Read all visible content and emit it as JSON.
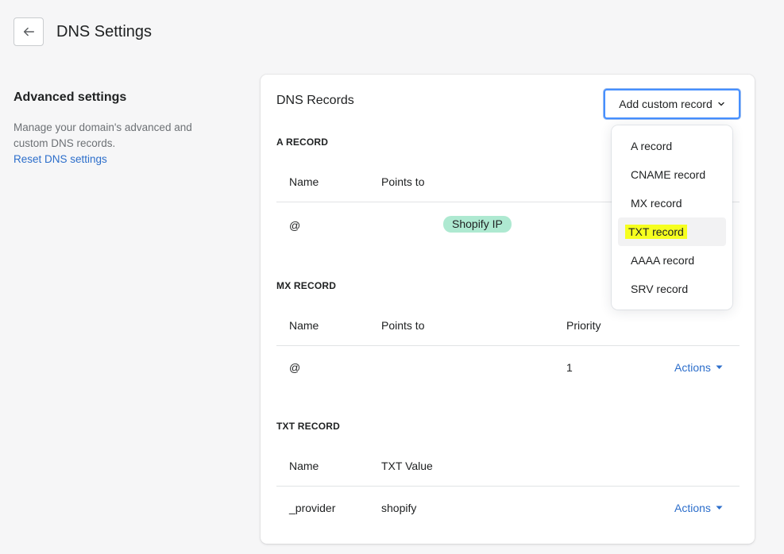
{
  "header": {
    "title": "DNS Settings",
    "back_icon": "arrow-left-icon"
  },
  "sidebar": {
    "heading": "Advanced settings",
    "description": "Manage your domain's advanced and custom DNS records.",
    "reset_link": "Reset DNS settings"
  },
  "card": {
    "title": "DNS Records",
    "add_button_label": "Add custom record",
    "add_button_icon": "chevron-down-icon"
  },
  "a_record": {
    "heading": "A RECORD",
    "columns": [
      "Name",
      "Points to"
    ],
    "rows": [
      {
        "name": "@",
        "points_to": "Shopify IP"
      }
    ]
  },
  "mx_record": {
    "heading": "MX RECORD",
    "columns": [
      "Name",
      "Points to",
      "Priority"
    ],
    "rows": [
      {
        "name": "@",
        "points_to": "",
        "priority": "1",
        "actions": "Actions"
      }
    ]
  },
  "txt_record": {
    "heading": "TXT RECORD",
    "columns": [
      "Name",
      "TXT Value"
    ],
    "rows": [
      {
        "name": "_provider",
        "txt_value": "shopify",
        "actions": "Actions"
      }
    ]
  },
  "dropdown": {
    "items": [
      {
        "label": "A record"
      },
      {
        "label": "CNAME record"
      },
      {
        "label": "MX record"
      },
      {
        "label": "TXT record",
        "active": true
      },
      {
        "label": "AAAA record"
      },
      {
        "label": "SRV record"
      }
    ]
  },
  "colors": {
    "link": "#2c6ecb",
    "badge_bg": "#aee9d1",
    "highlight": "#f6ff1f",
    "focus_border": "#458fff"
  }
}
